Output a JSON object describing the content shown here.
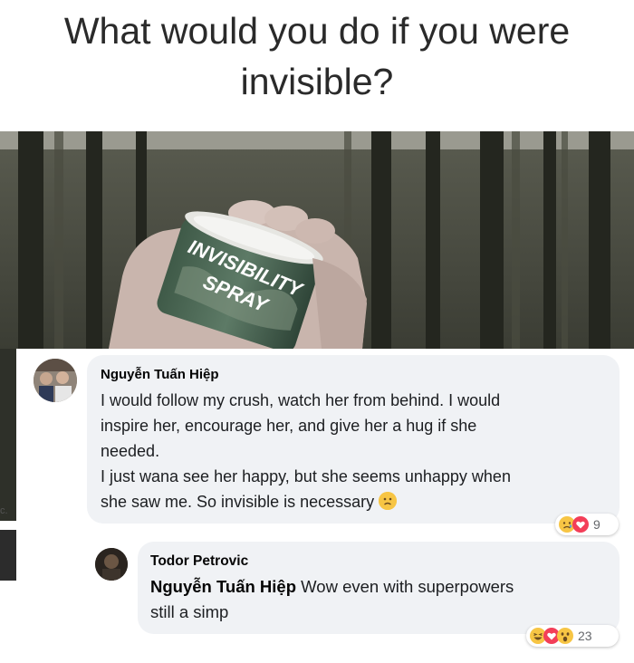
{
  "headline": {
    "line1": "What would you do if you were",
    "line2": "invisible?"
  },
  "photo": {
    "can_text_line1": "INVISIBILITY",
    "can_text_line2": "SPRAY"
  },
  "left_edge_text": "c.",
  "comments": [
    {
      "author": "Nguyễn Tuấn Hiệp",
      "lines": [
        "I would follow my crush, watch her from behind. I would",
        "inspire her, encourage her, and give her a hug if she",
        "needed.",
        "I just wana see her happy, but she seems unhappy when",
        "she saw me. So invisible is necessary"
      ],
      "reaction_icons": [
        "sad-face-icon",
        "heart-icon"
      ],
      "reaction_count": "9"
    },
    {
      "author": "Todor Petrovic",
      "tagged": "Nguyễn Tuấn Hiệp",
      "line1_rest": " Wow even with superpowers",
      "line2": "still a simp",
      "reaction_icons": [
        "laugh-face-icon",
        "heart-icon",
        "wow-face-icon"
      ],
      "reaction_count": "23"
    }
  ],
  "colors": {
    "bubble": "#f0f2f5",
    "heart": "#f33e58",
    "emoji_yellow": "#f7c544",
    "count_gray": "#65676b"
  }
}
